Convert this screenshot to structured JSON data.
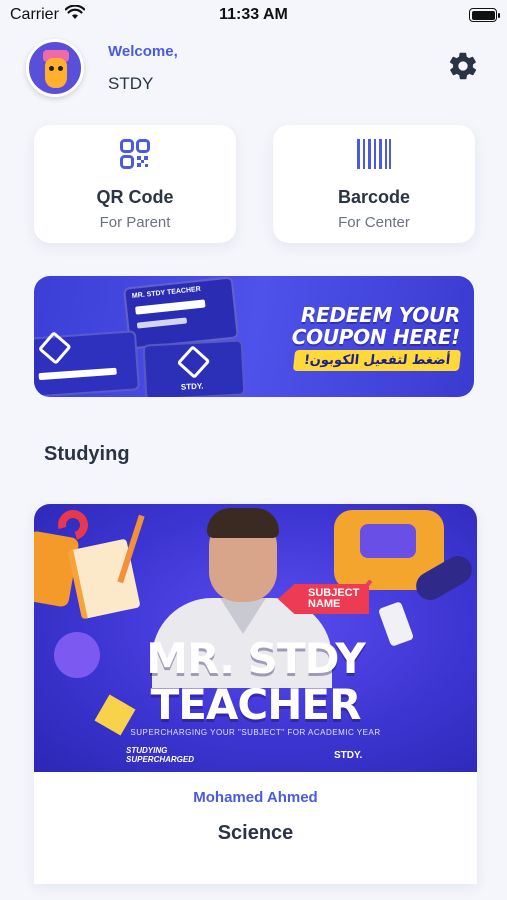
{
  "status_bar": {
    "carrier": "Carrier",
    "time": "11:33 AM",
    "battery_level": 1.0
  },
  "header": {
    "welcome": "Welcome,",
    "username": "STDY",
    "settings_icon": "gear-icon"
  },
  "cards": [
    {
      "title": "QR Code",
      "subtitle": "For Parent",
      "icon": "qr-code-icon"
    },
    {
      "title": "Barcode",
      "subtitle": "For Center",
      "icon": "barcode-icon"
    }
  ],
  "banner": {
    "headline_line1": "REDEEM YOUR",
    "headline_line2": "COUPON HERE!",
    "arabic_text": "أضغط لتفعيل الكوبون!",
    "mock_header": "MR. STDY TEACHER",
    "mock_brand": "STDY."
  },
  "section": {
    "title": "Studying"
  },
  "course": {
    "image_headline_line1": "MR. STDY",
    "image_headline_line2": "TEACHER",
    "subject_tag_line1": "SUBJECT",
    "subject_tag_line2": "NAME",
    "tagline": "SUPERCHARGING YOUR \"SUBJECT\" FOR ACADEMIC YEAR",
    "brand_left_line1": "STUDYING",
    "brand_left_line2": "SUPERCHARGED",
    "brand_right": "STDY.",
    "teacher": "Mohamed Ahmed",
    "subject": "Science"
  },
  "colors": {
    "accent": "#4a5be0",
    "background": "#f4f6fb",
    "banner_blue": "#3b3fd6",
    "coupon_yellow": "#ffd93a",
    "subject_red": "#ec3b53"
  }
}
